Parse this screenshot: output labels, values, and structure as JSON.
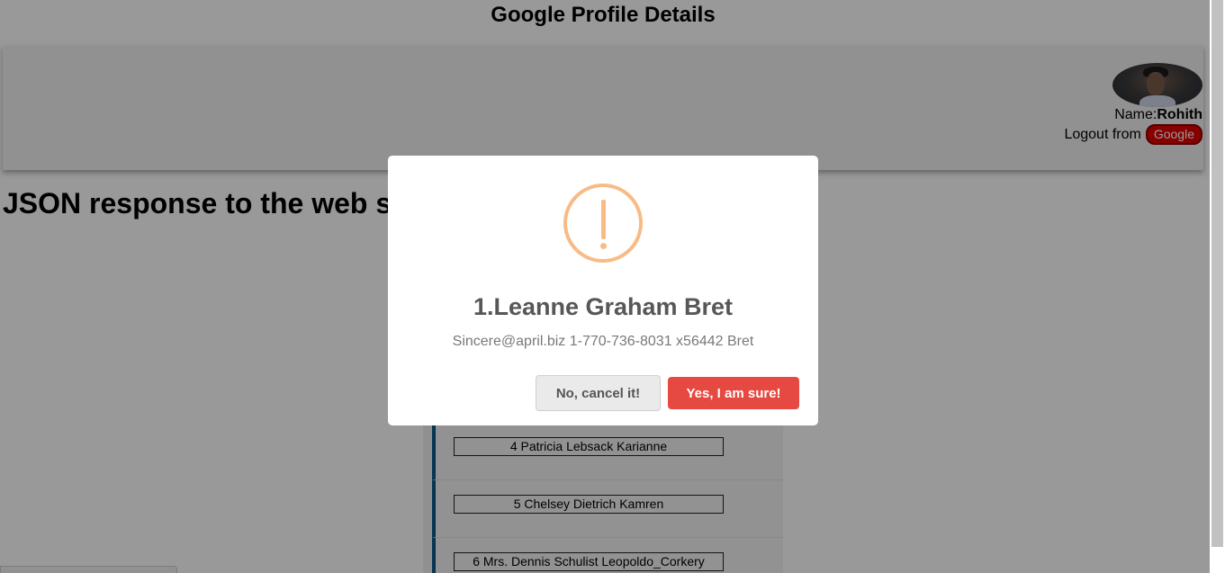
{
  "page": {
    "title": "Google Profile Details",
    "heading": "JSON response to the web service consists of the menu"
  },
  "profile": {
    "name_label": "Name:",
    "name_value": "Rohith",
    "logout_label": "Logout from",
    "google_button": "Google"
  },
  "users": [
    {
      "label": "4 Patricia Lebsack Karianne"
    },
    {
      "label": "5 Chelsey Dietrich Kamren"
    },
    {
      "label": "6 Mrs. Dennis Schulist Leopoldo_Corkery"
    }
  ],
  "dialog": {
    "title": "1.Leanne Graham Bret",
    "text": "Sincere@april.biz 1-770-736-8031 x56442 Bret",
    "cancel_label": "No, cancel it!",
    "confirm_label": "Yes, I am sure!",
    "icon": "warning-icon"
  },
  "colors": {
    "google_button": "#e10000",
    "confirm_button": "#e64942",
    "warning_icon": "#f8bb86",
    "list_accent": "#0a5a8a"
  }
}
